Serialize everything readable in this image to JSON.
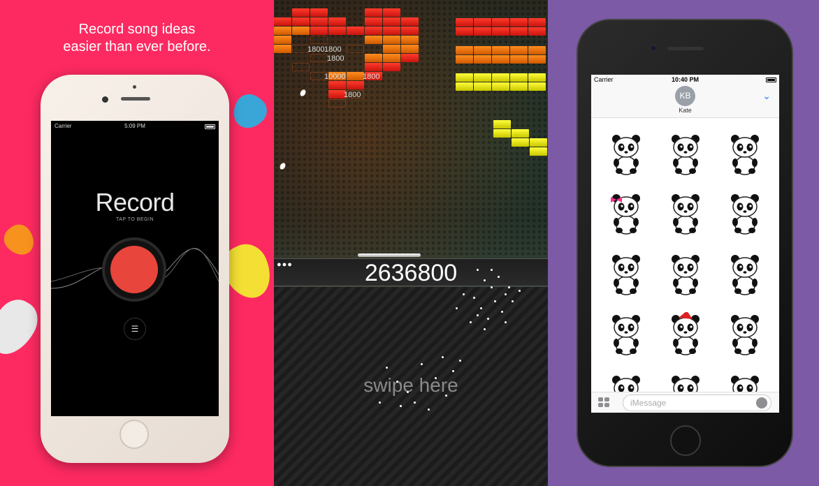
{
  "panel1": {
    "headline_line1": "Record song ideas",
    "headline_line2": "easier than ever before.",
    "status": {
      "carrier": "Carrier",
      "time": "5:09 PM"
    },
    "record_title": "Record",
    "record_subtitle": "TAP TO BEGIN",
    "list_icon": "list-icon"
  },
  "panel2": {
    "score": "2636800",
    "popups": [
      "1800",
      "1800",
      "1800",
      "10000",
      "1800",
      "1800"
    ],
    "lives": "●●●",
    "swipe_label": "swipe here"
  },
  "panel3": {
    "status": {
      "carrier": "Carrier",
      "time": "10:40 PM"
    },
    "avatar_initials": "KB",
    "contact_name": "Kate",
    "input_placeholder": "iMessage",
    "sticker_names": [
      "panda-sticker-1",
      "panda-sticker-2",
      "panda-sticker-3",
      "panda-sticker-4",
      "panda-sticker-5",
      "panda-sticker-6",
      "panda-sticker-7",
      "panda-sticker-8",
      "panda-sticker-9",
      "panda-sticker-10",
      "panda-sticker-11",
      "panda-sticker-12"
    ]
  },
  "colors": {
    "panel1_bg": "#fd2a61",
    "panel3_bg": "#7c5aa6",
    "record_red": "#e8453c",
    "imessage_blue": "#1f7ef5"
  }
}
